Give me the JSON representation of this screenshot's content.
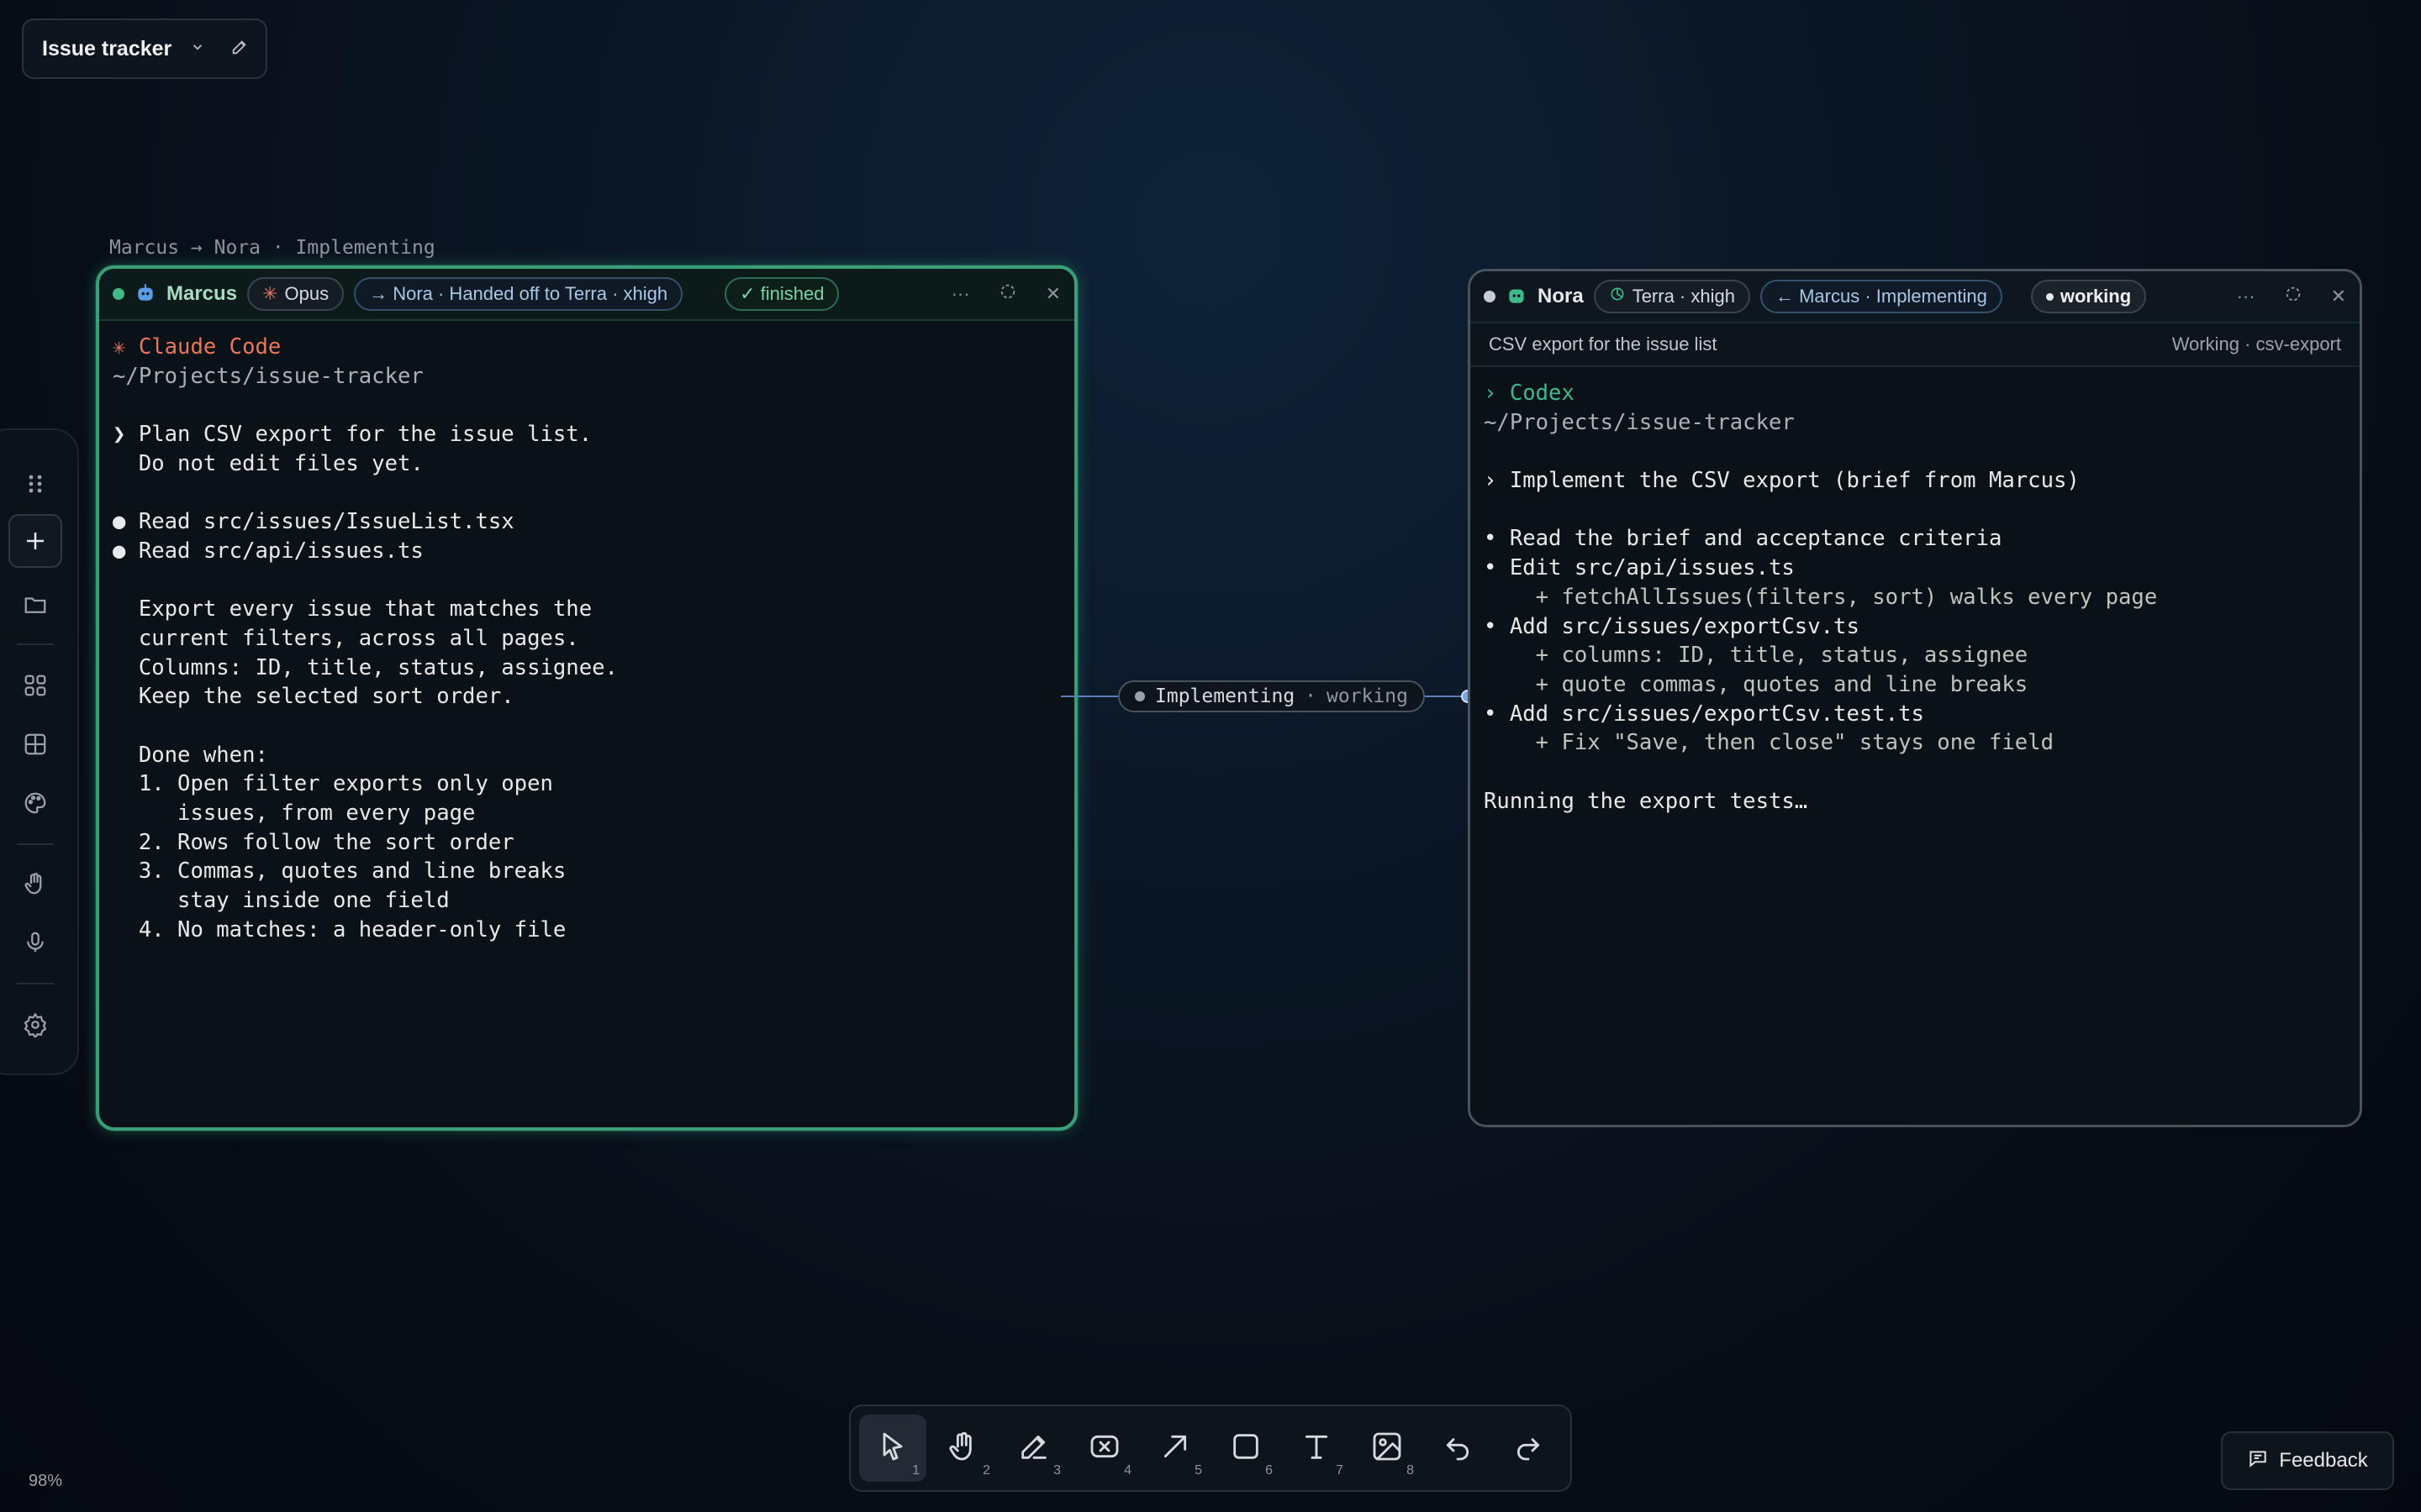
{
  "board": {
    "title": "Issue tracker"
  },
  "sidebar": {
    "items": [
      "drag-handle",
      "add",
      "folder",
      "apps",
      "grid",
      "palette",
      "hand",
      "microphone",
      "settings"
    ]
  },
  "left_panel": {
    "breadcrumb": "Marcus → Nora · Implementing",
    "agent": "Marcus",
    "model": "Opus",
    "handoff": "→ Nora · Handed off to Terra · xhigh",
    "status": "✓ finished",
    "terminal": [
      {
        "t": "✳ Claude Code",
        "c": "c-orange"
      },
      {
        "t": "~/Projects/issue-tracker",
        "c": "c-gray"
      },
      {
        "t": "",
        "c": ""
      },
      {
        "t": "❯ Plan CSV export for the issue list.",
        "c": ""
      },
      {
        "t": "  Do not edit files yet.",
        "c": ""
      },
      {
        "t": "",
        "c": ""
      },
      {
        "t": "● Read src/issues/IssueList.tsx",
        "c": ""
      },
      {
        "t": "● Read src/api/issues.ts",
        "c": ""
      },
      {
        "t": "",
        "c": ""
      },
      {
        "t": "  Export every issue that matches the",
        "c": ""
      },
      {
        "t": "  current filters, across all pages.",
        "c": ""
      },
      {
        "t": "  Columns: ID, title, status, assignee.",
        "c": ""
      },
      {
        "t": "  Keep the selected sort order.",
        "c": ""
      },
      {
        "t": "",
        "c": ""
      },
      {
        "t": "  Done when:",
        "c": ""
      },
      {
        "t": "  1. Open filter exports only open",
        "c": ""
      },
      {
        "t": "     issues, from every page",
        "c": ""
      },
      {
        "t": "  2. Rows follow the sort order",
        "c": ""
      },
      {
        "t": "  3. Commas, quotes and line breaks",
        "c": ""
      },
      {
        "t": "     stay inside one field",
        "c": ""
      },
      {
        "t": "  4. No matches: a header-only file",
        "c": ""
      }
    ]
  },
  "right_panel": {
    "agent": "Nora",
    "model": "Terra · xhigh",
    "handoff": "← Marcus · Implementing",
    "status": "working",
    "task": "CSV export for the issue list",
    "task_status": "Working · csv-export",
    "terminal": [
      {
        "t": "› Codex",
        "c": "c-green"
      },
      {
        "t": "~/Projects/issue-tracker",
        "c": "c-gray"
      },
      {
        "t": "",
        "c": ""
      },
      {
        "t": "› Implement the CSV export (brief from Marcus)",
        "c": ""
      },
      {
        "t": "",
        "c": ""
      },
      {
        "t": "• Read the brief and acceptance criteria",
        "c": ""
      },
      {
        "t": "• Edit src/api/issues.ts",
        "c": ""
      },
      {
        "t": "    + fetchAllIssues(filters, sort) walks every page",
        "c": "c-plus"
      },
      {
        "t": "• Add src/issues/exportCsv.ts",
        "c": ""
      },
      {
        "t": "    + columns: ID, title, status, assignee",
        "c": "c-plus"
      },
      {
        "t": "    + quote commas, quotes and line breaks",
        "c": "c-plus"
      },
      {
        "t": "• Add src/issues/exportCsv.test.ts",
        "c": ""
      },
      {
        "t": "    + Fix \"Save, then close\" stays one field",
        "c": "c-plus"
      },
      {
        "t": "",
        "c": ""
      },
      {
        "t": "Running the export tests…",
        "c": ""
      }
    ]
  },
  "connector": {
    "label": "Implementing",
    "status": "working"
  },
  "toolbar": {
    "tools": [
      {
        "name": "select",
        "num": "1"
      },
      {
        "name": "hand",
        "num": "2"
      },
      {
        "name": "pencil",
        "num": "3"
      },
      {
        "name": "eraser",
        "num": "4"
      },
      {
        "name": "arrow",
        "num": "5"
      },
      {
        "name": "rectangle",
        "num": "6"
      },
      {
        "name": "text",
        "num": "7"
      },
      {
        "name": "image",
        "num": "8"
      },
      {
        "name": "undo",
        "num": ""
      },
      {
        "name": "redo",
        "num": ""
      }
    ]
  },
  "feedback": {
    "label": "Feedback"
  },
  "zoom": "98%",
  "colors": {
    "accent_green": "#3a9e76",
    "connector_blue": "#5a7fb6",
    "orange": "#e8775a"
  }
}
